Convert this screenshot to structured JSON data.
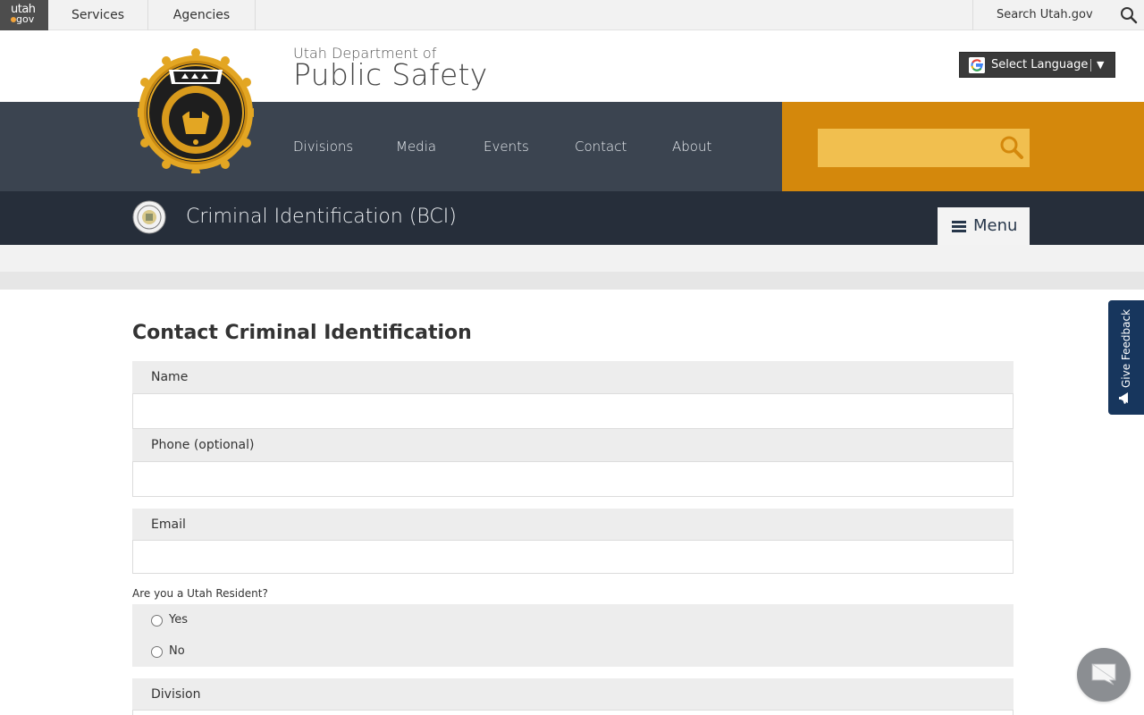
{
  "topbar": {
    "logo_top": "utah",
    "logo_bottom": "gov",
    "services": "Services",
    "agencies": "Agencies",
    "search_label": "Search Utah.gov"
  },
  "header": {
    "dept_small": "Utah Department of",
    "dept_big": "Public Safety",
    "language": "Select Language",
    "language_arrow": "▼"
  },
  "nav": {
    "items": [
      {
        "label": "Divisions"
      },
      {
        "label": "Media"
      },
      {
        "label": "Events"
      },
      {
        "label": "Contact"
      },
      {
        "label": "About"
      }
    ],
    "search_value": "",
    "search_placeholder": ""
  },
  "division": {
    "title": "Criminal Identification (BCI)",
    "menu_label": "Menu"
  },
  "form": {
    "title": "Contact Criminal Identification",
    "fields": [
      {
        "label": "Name",
        "value": ""
      },
      {
        "label": "Phone (optional)",
        "value": ""
      },
      {
        "label": "Email",
        "value": ""
      }
    ],
    "resident_question": "Are you a Utah Resident?",
    "resident_options": [
      "Yes",
      "No"
    ],
    "division_label": "Division"
  },
  "feedback": {
    "label": "Give Feedback"
  },
  "colors": {
    "nav_bg": "#3b4450",
    "accent_orange": "#d4880c",
    "search_field": "#f1bf4f",
    "division_bar": "#262e3a",
    "feedback_tab": "#17365d"
  },
  "icons": [
    "search-icon",
    "google-icon",
    "menu-icon",
    "megaphone-icon",
    "chat-icon"
  ]
}
